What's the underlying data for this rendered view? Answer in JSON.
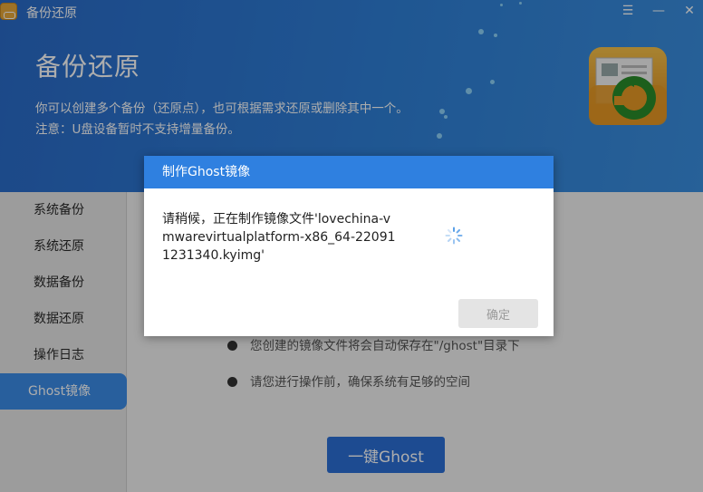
{
  "window": {
    "title": "备份还原",
    "controls": {
      "menu": "☰",
      "minimize": "—",
      "close": "✕"
    }
  },
  "header": {
    "title": "备份还原",
    "desc_line1": "你可以创建多个备份（还原点），也可根据需求还原或删除其中一个。",
    "desc_line2": "注意：U盘设备暂时不支持增量备份。",
    "icon": "backup-restore-icon"
  },
  "sidebar": {
    "items": [
      {
        "label": "系统备份"
      },
      {
        "label": "系统还原"
      },
      {
        "label": "数据备份"
      },
      {
        "label": "数据还原"
      },
      {
        "label": "操作日志"
      },
      {
        "label": "Ghost镜像",
        "active": true
      }
    ]
  },
  "content": {
    "bullets": [
      "您创建的镜像文件将会自动保存在\"/ghost\"目录下",
      "请您进行操作前，确保系统有足够的空间"
    ],
    "ghost_button": "一键Ghost"
  },
  "dialog": {
    "title": "制作Ghost镜像",
    "message": "请稍候，正在制作镜像文件'lovechina-vmwarevirtualplatform-x86_64-220911231340.kyimg'",
    "ok_button": "确定",
    "spinner": "loading-spinner-icon"
  },
  "colors": {
    "header_blue": "#2f80d8",
    "accent": "#3b8ce8",
    "dialog_header": "#2f80e0"
  }
}
